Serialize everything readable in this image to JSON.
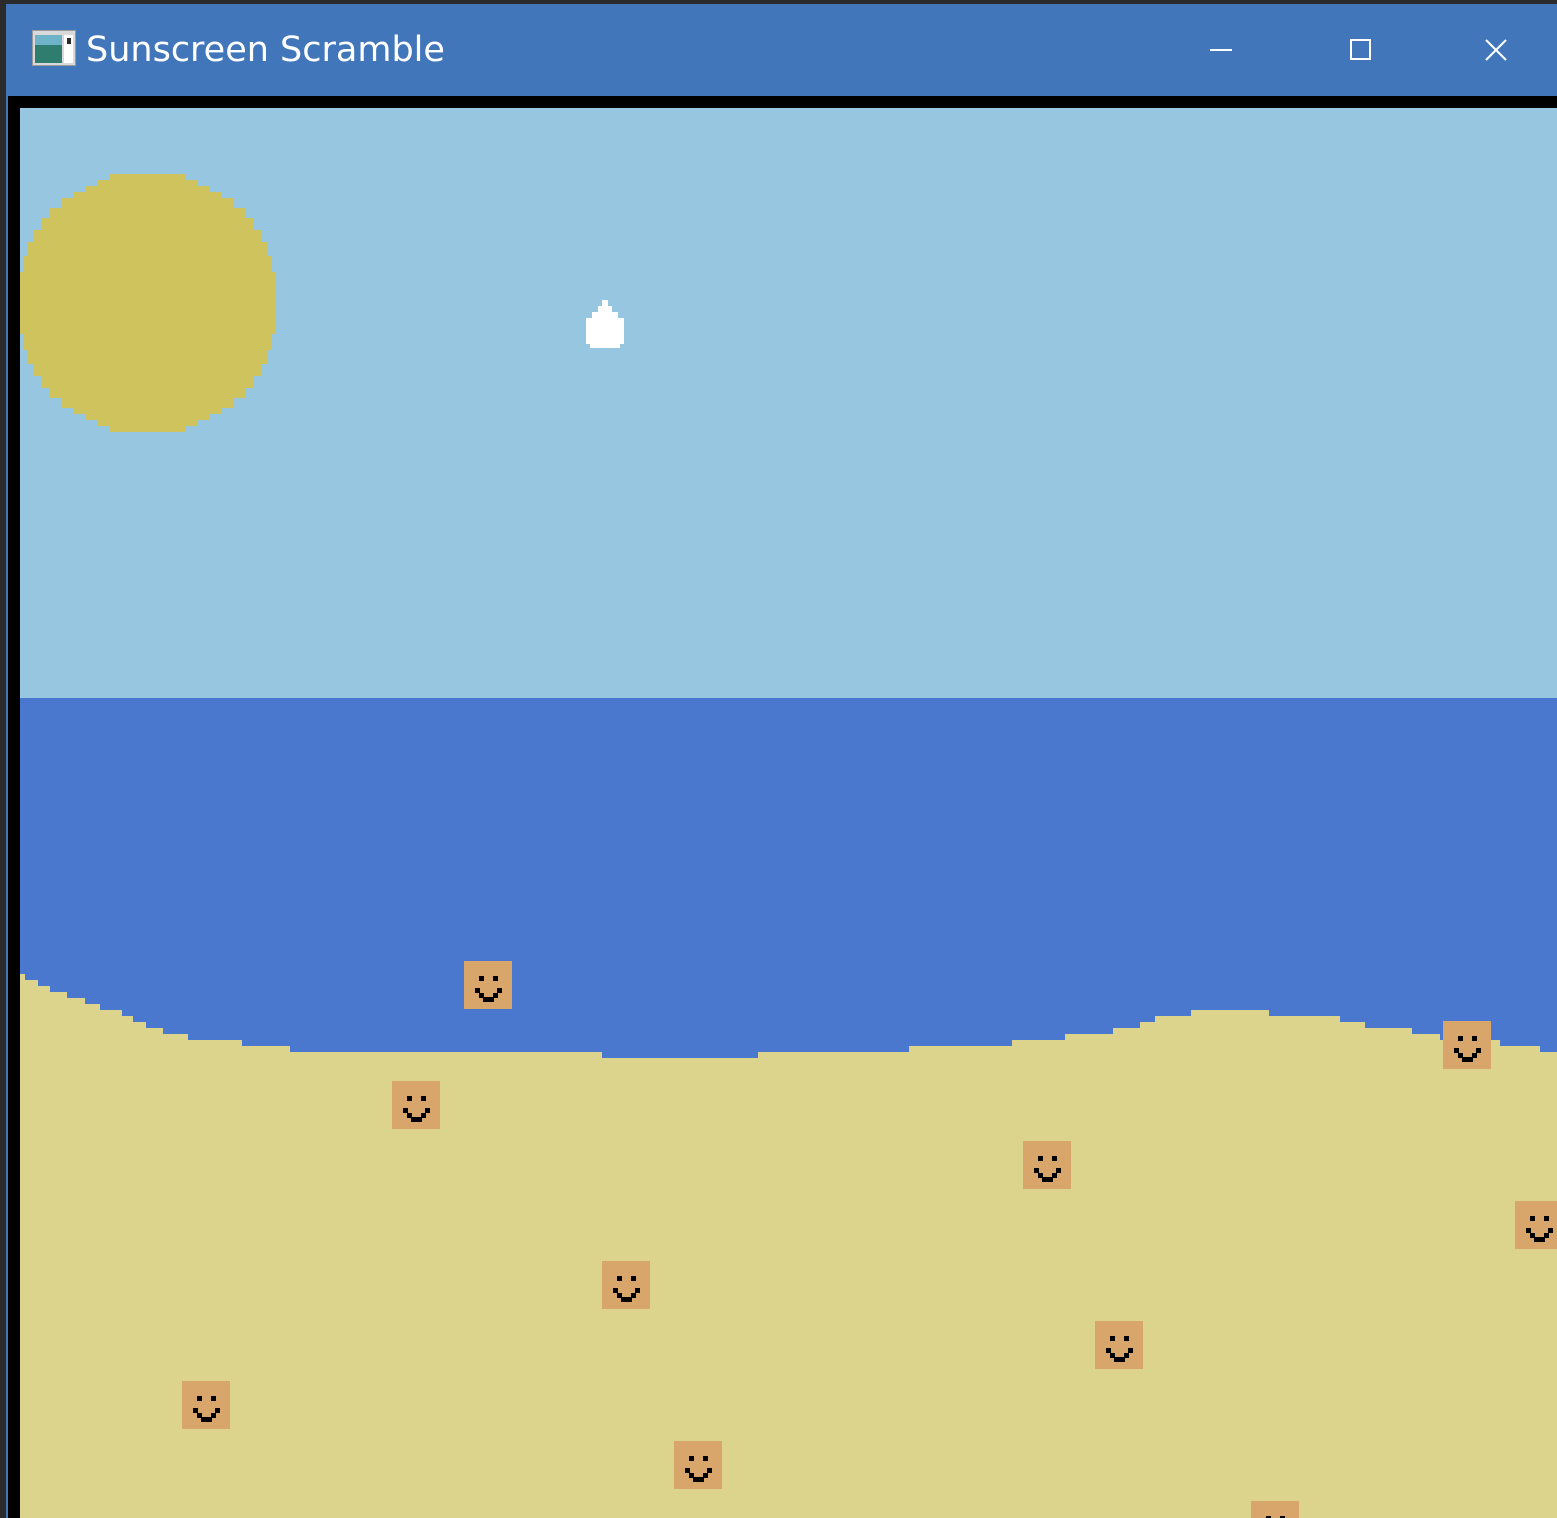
{
  "window": {
    "title": "Sunscreen Scramble",
    "controls": {
      "minimize": "minimize-icon",
      "maximize": "maximize-icon",
      "close": "close-icon"
    }
  },
  "game": {
    "colors": {
      "sky": "#97c7e0",
      "sea": "#4b78cf",
      "sand": "#dcd48d",
      "sun": "#cfc35e",
      "sunscreen_drop": "#ffffff",
      "face": "#d8a66b",
      "face_features": "#000000"
    },
    "sprites": {
      "sun": "sun",
      "drop": "sunscreen-drop",
      "face": "smiley-face"
    }
  }
}
